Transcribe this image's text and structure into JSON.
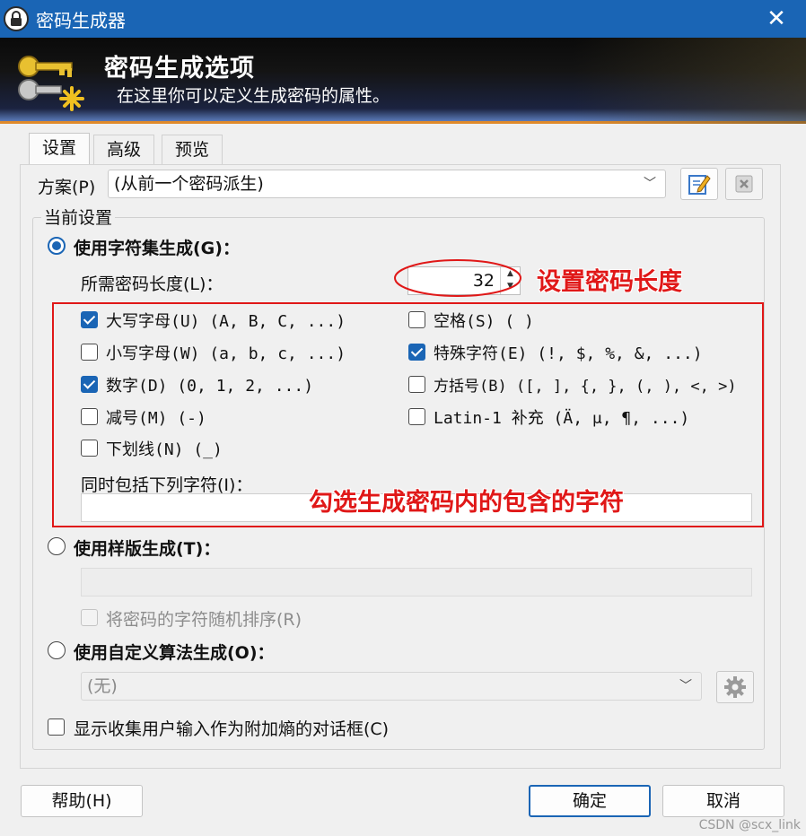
{
  "window": {
    "title": "密码生成器",
    "close_glyph": "✕"
  },
  "banner": {
    "heading": "密码生成选项",
    "subtitle": "在这里你可以定义生成密码的属性。"
  },
  "tabs": [
    {
      "label": "设置",
      "active": true
    },
    {
      "label": "高级",
      "active": false
    },
    {
      "label": "预览",
      "active": false
    }
  ],
  "profile": {
    "label": "方案(P)",
    "value": "(从前一个密码派生)",
    "edit_icon": "edit-icon",
    "delete_icon": "delete-icon"
  },
  "current_settings": {
    "group_label": "当前设置",
    "charset_mode": {
      "label": "使用字符集生成(G)：",
      "selected": true,
      "length_label": "所需密码长度(L)：",
      "length_value": "32",
      "options": [
        {
          "label": "大写字母(U) (A, B, C, ...)",
          "checked": true
        },
        {
          "label": "空格(S) ( )",
          "checked": false
        },
        {
          "label": "小写字母(W) (a, b, c, ...)",
          "checked": false
        },
        {
          "label": "特殊字符(E) (!, $, %, &, ...)",
          "checked": true
        },
        {
          "label": "数字(D) (0, 1, 2, ...)",
          "checked": true
        },
        {
          "label": "方括号(B) ([, ], {, }, (, ), <, >)",
          "checked": false
        },
        {
          "label": "减号(M) (-)",
          "checked": false
        },
        {
          "label": "Latin-1 补充 (Ä, μ, ¶, ...)",
          "checked": false
        },
        {
          "label": "下划线(N) (_)",
          "checked": false
        }
      ],
      "also_include_label": "同时包括下列字符(I)：",
      "also_include_value": ""
    },
    "pattern_mode": {
      "label": "使用样版生成(T)：",
      "selected": false,
      "pattern_value": "",
      "permute_label": "将密码的字符随机排序(R)",
      "permute_checked": false
    },
    "custom_mode": {
      "label": "使用自定义算法生成(O)：",
      "selected": false,
      "algorithm_value": "(无)",
      "settings_icon": "gear-icon"
    },
    "entropy_label": "显示收集用户输入作为附加熵的对话框(C)",
    "entropy_checked": false
  },
  "annotations": {
    "length_note": "设置密码长度",
    "charset_note": "勾选生成密码内的包含的字符"
  },
  "buttons": {
    "help": "帮助(H)",
    "ok": "确定",
    "cancel": "取消"
  },
  "watermark": "CSDN @scx_link",
  "colors": {
    "accent": "#1a65b5",
    "annotation": "#e01818",
    "banner_stripe": "#e08a2a"
  }
}
